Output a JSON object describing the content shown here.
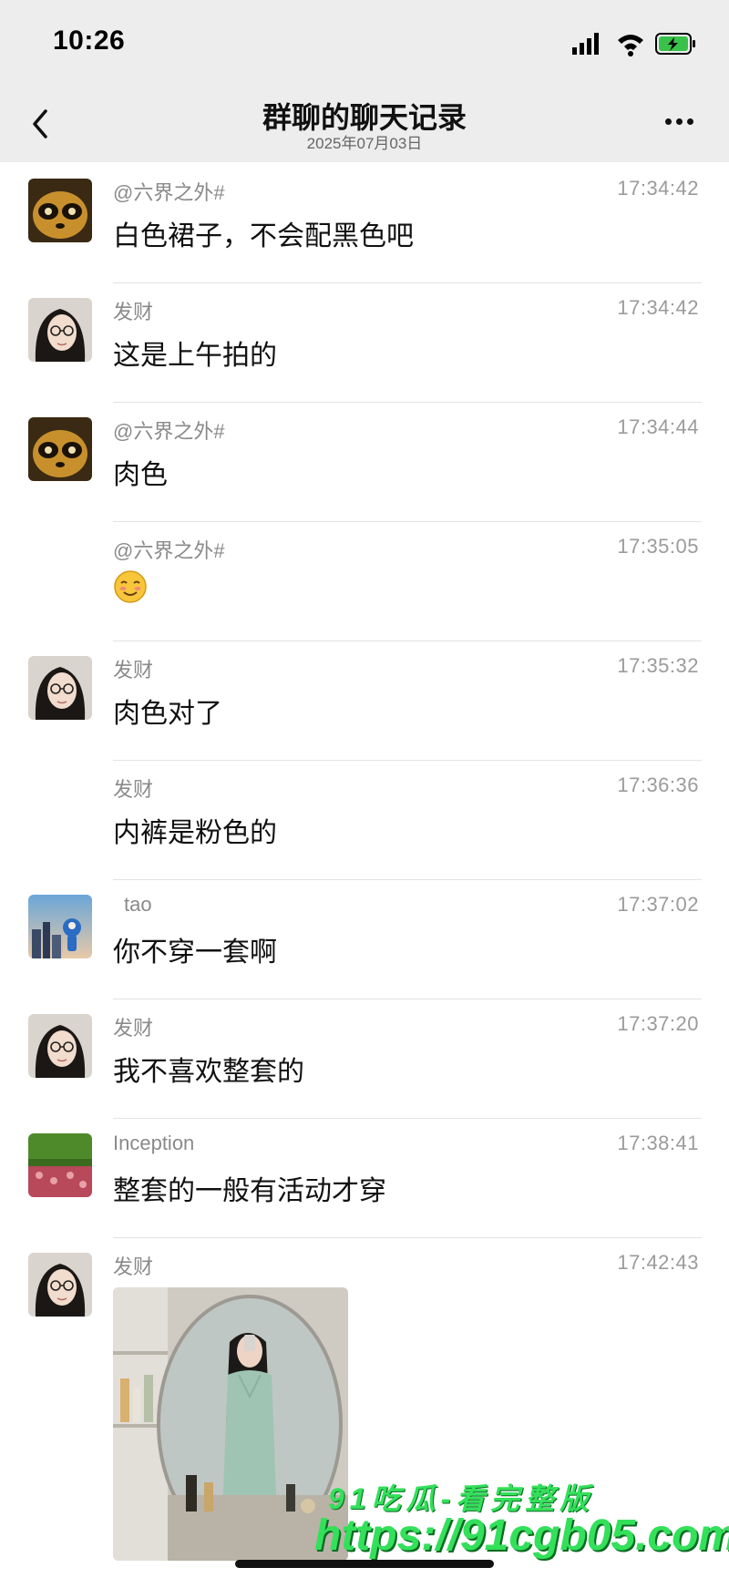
{
  "status_bar": {
    "time": "10:26"
  },
  "header": {
    "title": "群聊的聊天记录",
    "subtitle": "2025年07月03日"
  },
  "messages": [
    {
      "sender": "@六界之外#",
      "time": "17:34:42",
      "text": "白色裙子，不会配黑色吧",
      "avatar": "panda-avatar"
    },
    {
      "sender": "发财",
      "time": "17:34:42",
      "text": "这是上午拍的",
      "avatar": "girl-avatar"
    },
    {
      "sender": "@六界之外#",
      "time": "17:34:44",
      "text": "肉色",
      "avatar": "panda-avatar"
    },
    {
      "sender": "@六界之外#",
      "time": "17:35:05",
      "text": "",
      "avatar": "",
      "emoji": "smiling-emoji"
    },
    {
      "sender": "发财",
      "time": "17:35:32",
      "text": "肉色对了",
      "avatar": "girl-avatar"
    },
    {
      "sender": "发财",
      "time": "17:36:36",
      "text": "内裤是粉色的",
      "avatar": ""
    },
    {
      "sender": "tao",
      "time": "17:37:02",
      "text": "你不穿一套啊",
      "avatar": "city-avatar"
    },
    {
      "sender": "发财",
      "time": "17:37:20",
      "text": "我不喜欢整套的",
      "avatar": "girl-avatar"
    },
    {
      "sender": "Inception",
      "time": "17:38:41",
      "text": "整套的一般有活动才穿",
      "avatar": "field-avatar"
    },
    {
      "sender": "发财",
      "time": "17:42:43",
      "text": "",
      "avatar": "girl-avatar",
      "image": "mirror-selfie-photo"
    }
  ],
  "watermark": {
    "line1": "91吃瓜-看完整版",
    "line2": "https://91cgb05.com"
  },
  "colors": {
    "header_bg": "#ededed",
    "watermark": "#33e05a"
  }
}
